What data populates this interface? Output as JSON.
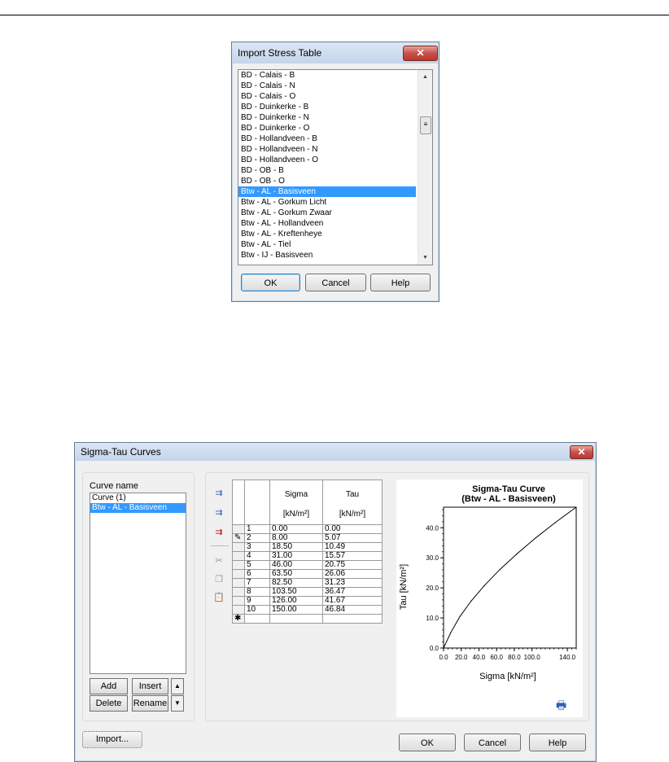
{
  "import_dialog": {
    "title": "Import Stress Table",
    "close_symbol": "✕",
    "items": [
      "BD - Calais - B",
      "BD - Calais - N",
      "BD - Calais - O",
      "BD - Duinkerke - B",
      "BD - Duinkerke - N",
      "BD - Duinkerke - O",
      "BD - Hollandveen - B",
      "BD - Hollandveen - N",
      "BD - Hollandveen - O",
      "BD - OB - B",
      "BD - OB - O",
      "Btw - AL - Basisveen",
      "Btw - AL - Gorkum Licht",
      "Btw - AL - Gorkum Zwaar",
      "Btw - AL - Hollandveen",
      "Btw - AL - Kreftenheye",
      "Btw - AL - Tiel",
      "Btw - IJ - Basisveen"
    ],
    "selected_item": "Btw - AL - Basisveen",
    "buttons": {
      "ok": "OK",
      "cancel": "Cancel",
      "help": "Help"
    }
  },
  "sigma_tau_dialog": {
    "title": "Sigma-Tau Curves",
    "close_symbol": "✕",
    "curve_name_label": "Curve name",
    "curves": [
      "Curve (1)",
      "Btw - AL - Basisveen"
    ],
    "selected_curve": "Btw - AL - Basisveen",
    "buttons": {
      "add": "Add",
      "insert": "Insert",
      "delete": "Delete",
      "rename": "Rename",
      "import": "Import...",
      "ok": "OK",
      "cancel": "Cancel",
      "help": "Help"
    },
    "table": {
      "headers": [
        "Sigma",
        "Tau"
      ],
      "units": [
        "[kN/m²]",
        "[kN/m²]"
      ],
      "rows": [
        [
          "1",
          "0.00",
          "0.00"
        ],
        [
          "2",
          "8.00",
          "5.07"
        ],
        [
          "3",
          "18.50",
          "10.49"
        ],
        [
          "4",
          "31.00",
          "15.57"
        ],
        [
          "5",
          "46.00",
          "20.75"
        ],
        [
          "6",
          "63.50",
          "26.06"
        ],
        [
          "7",
          "82.50",
          "31.23"
        ],
        [
          "8",
          "103.50",
          "36.47"
        ],
        [
          "9",
          "126.00",
          "41.67"
        ],
        [
          "10",
          "150.00",
          "46.84"
        ]
      ],
      "new_row_marker": "✱",
      "edit_marker": "✎"
    },
    "chart_data": {
      "type": "line",
      "title": "Sigma-Tau Curve",
      "subtitle": "(Btw - AL - Basisveen)",
      "xlabel": "Sigma [kN/m²]",
      "ylabel": "Tau [kN/m²]",
      "x": [
        0.0,
        8.0,
        18.5,
        31.0,
        46.0,
        63.5,
        82.5,
        103.5,
        126.0,
        150.0
      ],
      "y": [
        0.0,
        5.07,
        10.49,
        15.57,
        20.75,
        26.06,
        31.23,
        36.47,
        41.67,
        46.84
      ],
      "xlim": [
        0,
        150
      ],
      "ylim": [
        0,
        46.84
      ],
      "xticks": [
        "0.0",
        "20.0",
        "40.0",
        "60.0",
        "80.0",
        "100.0",
        "140.0"
      ],
      "xtick_values": [
        0,
        20,
        40,
        60,
        80,
        100,
        140
      ],
      "yticks": [
        "0.0",
        "10.0",
        "20.0",
        "30.0",
        "40.0"
      ],
      "ytick_values": [
        0,
        10,
        20,
        30,
        40
      ],
      "grid": false,
      "line_color": "#000000"
    }
  }
}
